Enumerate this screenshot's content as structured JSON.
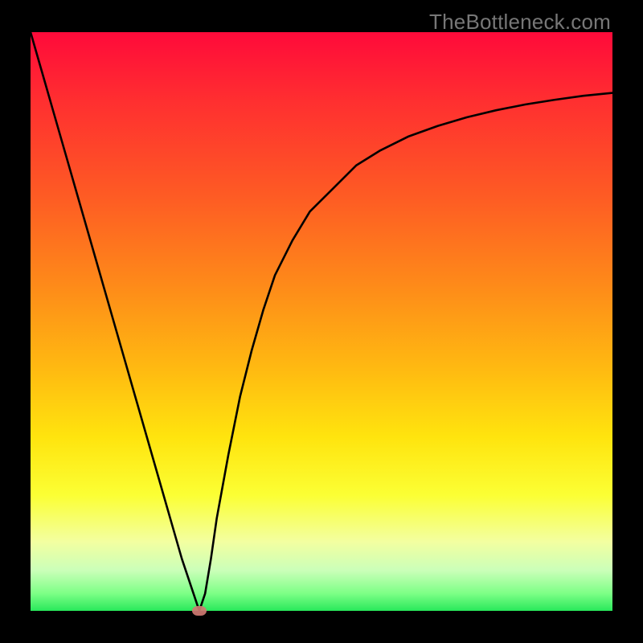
{
  "watermark": "TheBottleneck.com",
  "chart_data": {
    "type": "line",
    "title": "",
    "xlabel": "",
    "ylabel": "",
    "xlim": [
      0,
      100
    ],
    "ylim": [
      0,
      100
    ],
    "grid": false,
    "series": [
      {
        "name": "curve",
        "x": [
          0,
          2,
          4,
          6,
          8,
          10,
          12,
          14,
          16,
          18,
          20,
          22,
          24,
          26,
          28,
          29,
          30,
          31,
          32,
          34,
          36,
          38,
          40,
          42,
          45,
          48,
          52,
          56,
          60,
          65,
          70,
          75,
          80,
          85,
          90,
          95,
          100
        ],
        "y": [
          100,
          93,
          86,
          79,
          72,
          65,
          58,
          51,
          44,
          37,
          30,
          23,
          16,
          9,
          3,
          0,
          3,
          9,
          16,
          27,
          37,
          45,
          52,
          58,
          64,
          69,
          73,
          77,
          79.5,
          82,
          83.8,
          85.3,
          86.5,
          87.5,
          88.3,
          89,
          89.5
        ]
      }
    ],
    "marker": {
      "x": 29,
      "y": 0
    },
    "colors": {
      "curve": "#000000",
      "marker": "#cf7a72",
      "background_top": "#ff0a3a",
      "background_bottom": "#28e85b"
    }
  }
}
